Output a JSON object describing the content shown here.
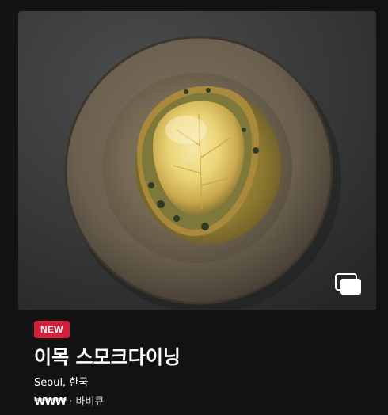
{
  "badge": {
    "label": "NEW",
    "color": "#d21f3c"
  },
  "restaurant": {
    "name": "이목 스모크다이닝",
    "location": "Seoul, 한국",
    "price": "₩₩₩",
    "separator": " · ",
    "cuisine": "바비큐"
  },
  "photo": {
    "subject": "plated dish in stoneware bowl",
    "gallery_icon": "photo-gallery-icon"
  },
  "colors": {
    "background": "#121212",
    "text": "#ffffff"
  }
}
